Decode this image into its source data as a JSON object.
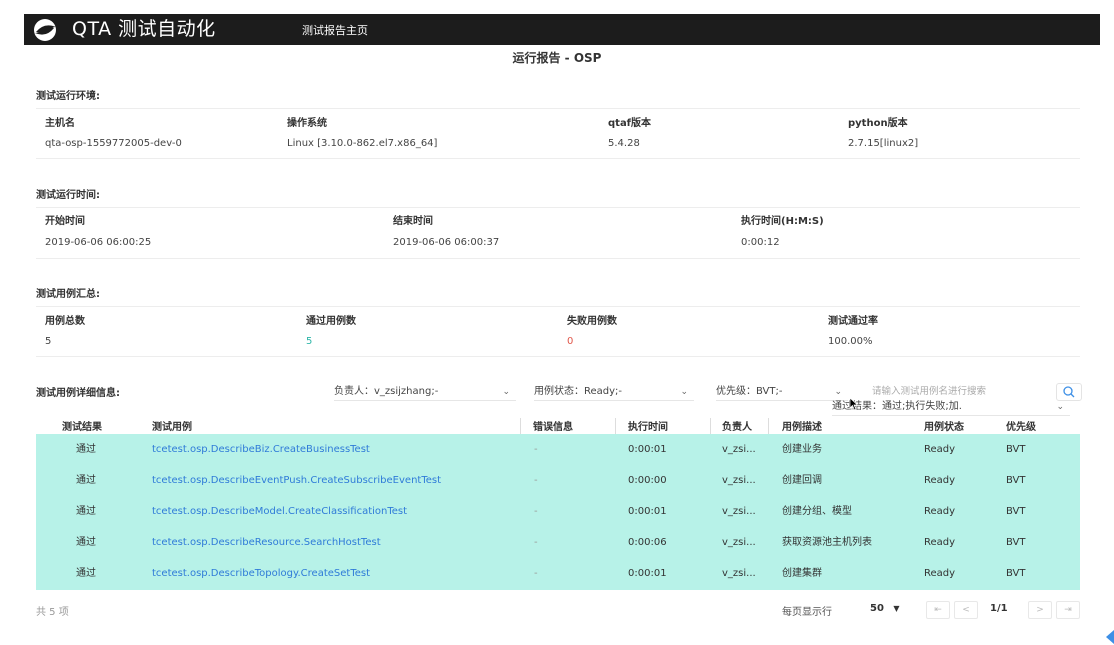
{
  "header": {
    "logo_text": "QTA 测试自动化",
    "nav_home": "测试报告主页"
  },
  "report_title": "运行报告 - OSP",
  "environment": {
    "title": "测试运行环境:",
    "headers": [
      "主机名",
      "操作系统",
      "qtaf版本",
      "python版本"
    ],
    "values": [
      "qta-osp-1559772005-dev-0",
      "Linux [3.10.0-862.el7.x86_64]",
      "5.4.28",
      "2.7.15[linux2]"
    ]
  },
  "run_time": {
    "title": "测试运行时间:",
    "headers": [
      "开始时间",
      "结束时间",
      "执行时间(H:M:S)"
    ],
    "values": [
      "2019-06-06 06:00:25",
      "2019-06-06 06:00:37",
      "0:00:12"
    ]
  },
  "summary": {
    "title": "测试用例汇总:",
    "headers": [
      "用例总数",
      "通过用例数",
      "失败用例数",
      "测试通过率"
    ],
    "values": [
      "5",
      "5",
      "0",
      "100.00%"
    ],
    "colors": {
      "pass": "#2bb5a7",
      "fail": "#e0574a"
    }
  },
  "details": {
    "title": "测试用例详细信息:",
    "filters": {
      "owner": "负责人：v_zsijzhang;-",
      "status": "用例状态：Ready;-",
      "priority": "优先级：BVT;-",
      "result": "通过结果：通过;执行失败;加.",
      "search_placeholder": "请输入测试用例名进行搜索"
    },
    "columns": [
      "测试结果",
      "测试用例",
      "错误信息",
      "执行时间",
      "负责人",
      "用例描述",
      "用例状态",
      "优先级"
    ],
    "rows": [
      [
        "通过",
        "tcetest.osp.DescribeBiz.CreateBusinessTest",
        "-",
        "0:00:01",
        "v_zsi...",
        "创建业务",
        "Ready",
        "BVT"
      ],
      [
        "通过",
        "tcetest.osp.DescribeEventPush.CreateSubscribeEventTest",
        "-",
        "0:00:00",
        "v_zsi...",
        "创建回调",
        "Ready",
        "BVT"
      ],
      [
        "通过",
        "tcetest.osp.DescribeModel.CreateClassificationTest",
        "-",
        "0:00:01",
        "v_zsi...",
        "创建分组、模型",
        "Ready",
        "BVT"
      ],
      [
        "通过",
        "tcetest.osp.DescribeResource.SearchHostTest",
        "-",
        "0:00:06",
        "v_zsi...",
        "获取资源池主机列表",
        "Ready",
        "BVT"
      ],
      [
        "通过",
        "tcetest.osp.DescribeTopology.CreateSetTest",
        "-",
        "0:00:01",
        "v_zsi...",
        "创建集群",
        "Ready",
        "BVT"
      ]
    ],
    "row_color": "#b7f2e8",
    "link_color": "#2f7bd8"
  },
  "footer": {
    "count": "共 5 项",
    "per_page_label": "每页显示行",
    "per_page": "50",
    "page": "1/1",
    "first": "⇤",
    "prev": "<",
    "next": ">",
    "last": "⇥"
  }
}
